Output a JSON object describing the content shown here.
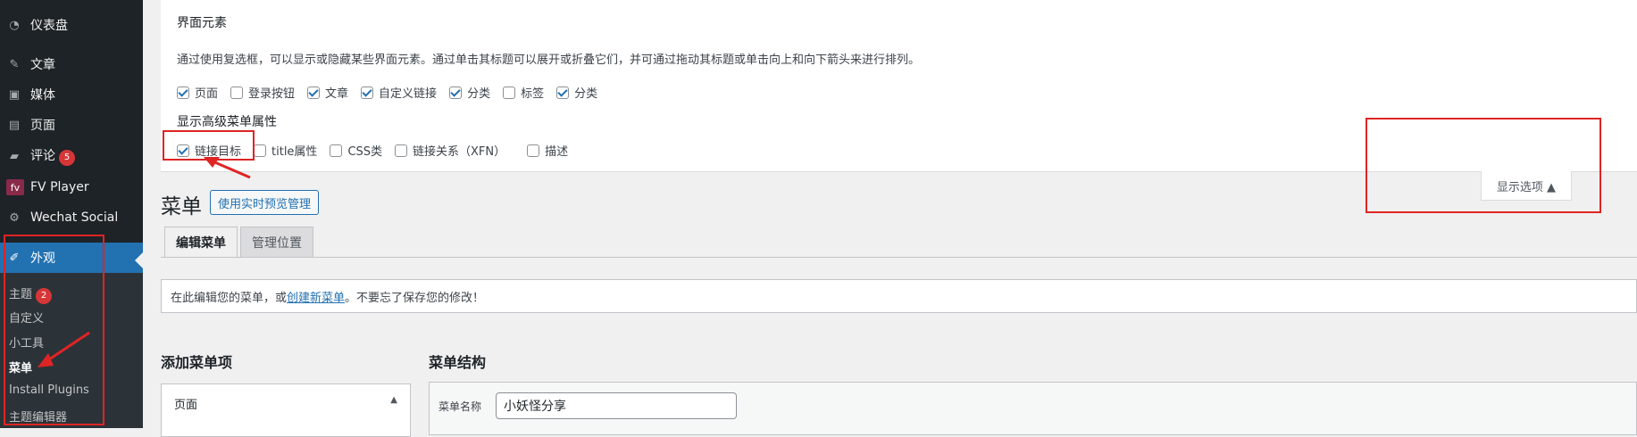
{
  "sidebar": {
    "items": [
      {
        "label": "仪表盘",
        "icon": "dashboard-icon"
      },
      {
        "label": "文章",
        "icon": "pin-icon"
      },
      {
        "label": "媒体",
        "icon": "media-icon"
      },
      {
        "label": "页面",
        "icon": "page-icon"
      },
      {
        "label": "评论",
        "icon": "comment-icon",
        "badge": "5"
      },
      {
        "label": "FV Player",
        "icon": "fv-player-icon"
      },
      {
        "label": "Wechat Social",
        "icon": "gear-icon"
      },
      {
        "label": "外观",
        "icon": "brush-icon"
      }
    ],
    "submenu": [
      {
        "label": "主题",
        "badge": "2"
      },
      {
        "label": "自定义"
      },
      {
        "label": "小工具"
      },
      {
        "label": "菜单"
      },
      {
        "label": "Install Plugins"
      },
      {
        "label": "主题编辑器"
      }
    ]
  },
  "screen_options": {
    "title": "界面元素",
    "description": "通过使用复选框，可以显示或隐藏某些界面元素。通过单击其标题可以展开或折叠它们，并可通过拖动其标题或单击向上和向下箭头来进行排列。",
    "boxes": [
      {
        "label": "页面",
        "checked": true
      },
      {
        "label": "登录按钮",
        "checked": false
      },
      {
        "label": "文章",
        "checked": true
      },
      {
        "label": "自定义链接",
        "checked": true
      },
      {
        "label": "分类",
        "checked": true
      },
      {
        "label": "标签",
        "checked": false
      },
      {
        "label": "分类",
        "checked": true
      }
    ],
    "advanced_title": "显示高级菜单属性",
    "advanced": [
      {
        "label": "链接目标",
        "checked": true
      },
      {
        "label": "title属性",
        "checked": false
      },
      {
        "label": "CSS类",
        "checked": false
      },
      {
        "label": "链接关系（XFN）",
        "checked": false
      },
      {
        "label": "描述",
        "checked": false
      }
    ],
    "toggle_label": "显示选项 ▲"
  },
  "page": {
    "title": "菜单",
    "preview_button": "使用实时预览管理",
    "tabs": [
      "编辑菜单",
      "管理位置"
    ],
    "notice_before": "在此编辑您的菜单，或",
    "notice_link": "创建新菜单",
    "notice_after": "。不要忘了保存您的修改！",
    "add_items_title": "添加菜单项",
    "structure_title": "菜单结构",
    "pages_panel_label": "页面",
    "menu_name_label": "菜单名称",
    "menu_name_value": "小妖怪分享"
  },
  "colors": {
    "annotation": "#e02424",
    "accent": "#2271b1",
    "sidebar": "#1d2327"
  }
}
